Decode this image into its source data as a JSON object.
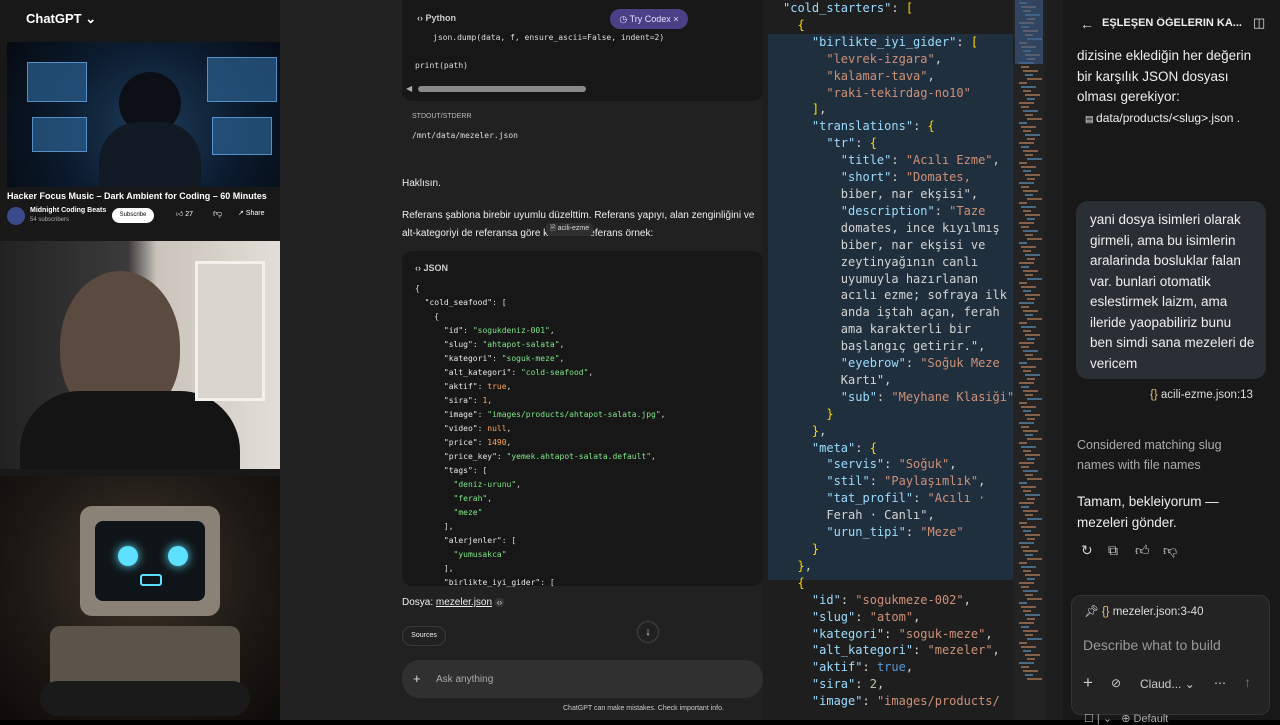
{
  "left": {
    "app_title": "ChatGPT",
    "video": {
      "title": "Hacker Focus Music – Dark Ambient for Coding – 60 Minutes",
      "channel": "Midnight Coding Beats",
      "subscribers": "54 subscribers",
      "subscribe_label": "Subscribe",
      "likes": "27",
      "share_label": "Share"
    }
  },
  "chat": {
    "code_top": {
      "lang_label": "Python",
      "try_codex_label": "Try Codex",
      "line1": "json.dump(data, f, ensure_ascii=False, indent=2)",
      "line2": "print(path)",
      "stdout_label": "STDOUT/STDERR",
      "stdout_value": "/mnt/data/mezeler.json"
    },
    "reply_title": "Haklısın.",
    "reply_para": "Referans şablona birebir uyumlu düzelttim. Referans yapıyı, alan zenginliğini ve alt-kategoriyi de referansa göre kurdum. Referans örnek:",
    "ref_chip": "acili-ezme",
    "json_label": "JSON",
    "json_lines": [
      "{",
      "  \"cold_seafood\": [",
      "    {",
      "      \"id\": \"sogukdeniz-001\",",
      "      \"slug\": \"ahtapot-salata\",",
      "      \"kategori\": \"soguk-meze\",",
      "      \"alt_kategori\": \"cold-seafood\",",
      "      \"aktif\": true,",
      "      \"sira\": 1,",
      "      \"image\": \"images/products/ahtapot-salata.jpg\",",
      "      \"video\": null,",
      "      \"price\": 1490,",
      "      \"price_key\": \"yemek.ahtapot-salata.default\",",
      "      \"tags\": [",
      "        \"deniz-urunu\",",
      "        \"ferah\",",
      "        \"meze\"",
      "      ],",
      "      \"alerjenler\": [",
      "        \"yumusakca\"",
      "      ],",
      "      \"birlikte_iyi_gider\": ["
    ],
    "file_label": "Dosya:",
    "file_link": "mezeler.json",
    "sources_label": "Sources",
    "ask_placeholder": "Ask anything",
    "footer": "ChatGPT can make mistakes. Check important info."
  },
  "editor": {
    "lines": [
      "\"cold_starters\": [",
      "  {",
      "    \"birlikte_iyi_gider\": [",
      "      \"levrek-izgara\",",
      "      \"kalamar-tava\",",
      "      \"raki-tekirdag-no10\"",
      "    ],",
      "    \"translations\": {",
      "      \"tr\": {",
      "        \"title\": \"Acılı Ezme\",",
      "        \"short\": \"Domates,",
      "        biber, nar ekşisi\",",
      "        \"description\": \"Taze",
      "        domates, ince kıyılmış",
      "        biber, nar ekşisi ve",
      "        zeytinyağının canlı",
      "        uyumuyla hazırlanan",
      "        acılı ezme; sofraya ilk",
      "        anda iştah açan, ferah",
      "        ama karakterli bir",
      "        başlangıç getirir.\",",
      "        \"eyebrow\": \"Soğuk Meze",
      "        Kartı\",",
      "        \"sub\": \"Meyhane Klasiği\"",
      "      }",
      "    },",
      "    \"meta\": {",
      "      \"servis\": \"Soğuk\",",
      "      \"stil\": \"Paylaşımlık\",",
      "      \"tat_profil\": \"Acılı ·",
      "      Ferah · Canlı\",",
      "      \"urun_tipi\": \"Meze\"",
      "    }",
      "  },",
      "  {",
      "    \"id\": \"sogukmeze-002\",",
      "    \"slug\": \"atom\",",
      "    \"kategori\": \"soguk-meze\",",
      "    \"alt_kategori\": \"mezeler\",",
      "    \"aktif\": true,",
      "    \"sira\": 2,",
      "    \"image\": \"images/products/"
    ]
  },
  "panel": {
    "title": "EŞLEŞEN ÖĞELERIN KA...",
    "assistant_text": "dizisine eklediğin her değerin bir karşılık JSON dosyası olması gerekiyor:",
    "path": "data/products/<slug>.json",
    "user_message": "yani dosya isimleri olarak girmeli, ama bu isimlerin aralarinda bosluklar falan var. bunlari otomatik eslestirmek laizm, ama ileride yaopabiliriz bunu ben simdi sana mezeleri de vericem",
    "file_ref": "acili-ezme.json:13",
    "considered": "Considered matching slug names with file names",
    "reply": "Tamam, bekleiyorum — mezeleri gönder.",
    "ctx_chip": "mezeler.json:3-40",
    "input_placeholder": "Describe what to build",
    "model_label": "Claud...",
    "bottom_label": "Default"
  }
}
